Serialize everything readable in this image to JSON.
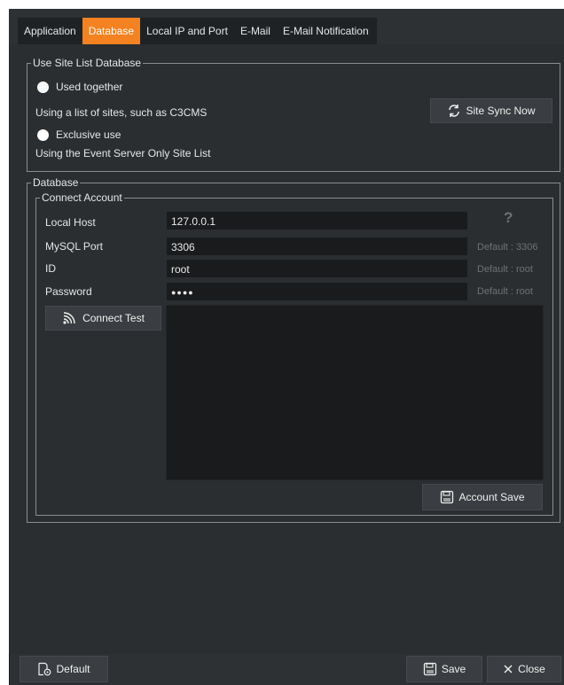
{
  "tabs": [
    {
      "label": "Application"
    },
    {
      "label": "Database"
    },
    {
      "label": "Local IP and Port"
    },
    {
      "label": "E-Mail"
    },
    {
      "label": "E-Mail Notification"
    }
  ],
  "active_tab": "Database",
  "site_list": {
    "legend": "Use Site List Database",
    "option1_label": "Used together",
    "option1_desc": "Using a list of sites, such as C3CMS",
    "option2_label": "Exclusive use",
    "option2_desc": "Using the Event Server Only Site List",
    "sync_button": "Site Sync Now"
  },
  "database": {
    "legend": "Database",
    "account_legend": "Connect Account",
    "fields": [
      {
        "label": "Local Host",
        "value": "127.0.0.1",
        "hint": "?"
      },
      {
        "label": "MySQL Port",
        "value": "3306",
        "hint": "Default : 3306"
      },
      {
        "label": "ID",
        "value": "root",
        "hint": "Default : root"
      },
      {
        "label": "Password",
        "value": "●●●●",
        "hint": "Default : root"
      }
    ],
    "connect_test_button": "Connect Test",
    "account_save_button": "Account Save"
  },
  "footer": {
    "default_button": "Default",
    "save_button": "Save",
    "close_button": "Close"
  },
  "colors": {
    "accent": "#f58220",
    "background": "#2b2e31",
    "field": "#191b1d"
  }
}
